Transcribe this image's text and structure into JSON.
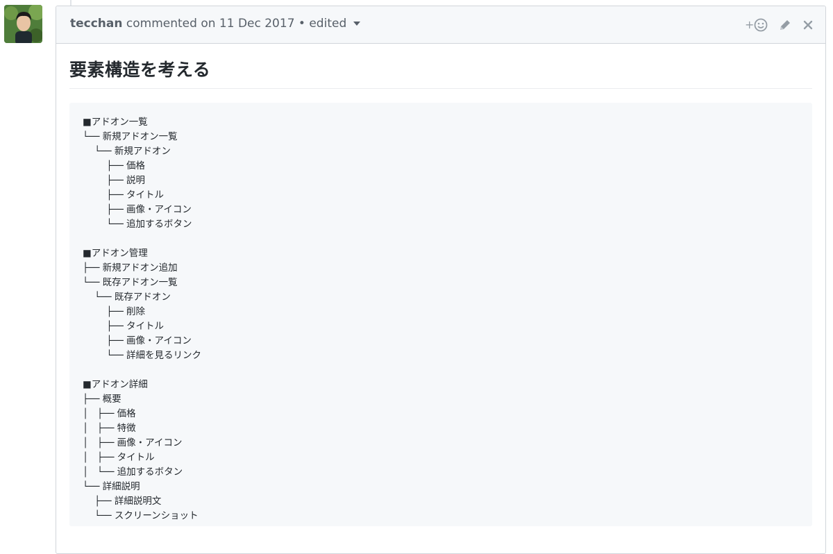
{
  "comment": {
    "author": "tecchan",
    "meta_text": "commented on 11 Dec 2017 • edited",
    "actions": {
      "reaction_icon": "add-reaction-icon",
      "edit_icon": "pencil-icon",
      "close_icon": "close-icon"
    },
    "title": "要素構造を考える",
    "code_lines": [
      "■アドオン一覧",
      "└── 新規アドオン一覧",
      "    └── 新規アドオン",
      "        ├── 価格",
      "        ├── 説明",
      "        ├── タイトル",
      "        ├── 画像・アイコン",
      "        └── 追加するボタン",
      "",
      "■アドオン管理",
      "├── 新規アドオン追加",
      "└── 既存アドオン一覧",
      "    └── 既存アドオン",
      "        ├── 削除",
      "        ├── タイトル",
      "        ├── 画像・アイコン",
      "        └── 詳細を見るリンク",
      "",
      "■アドオン詳細",
      "├── 概要",
      "│   ├── 価格",
      "│   ├── 特徴",
      "│   ├── 画像・アイコン",
      "│   ├── タイトル",
      "│   └── 追加するボタン",
      "└── 詳細説明",
      "    ├── 詳細説明文",
      "    └── スクリーンショット"
    ]
  },
  "colors": {
    "header_bg": "#f6f8fa",
    "border": "#d1d5da",
    "muted_text": "#586069",
    "code_bg": "#f6f8fa"
  }
}
